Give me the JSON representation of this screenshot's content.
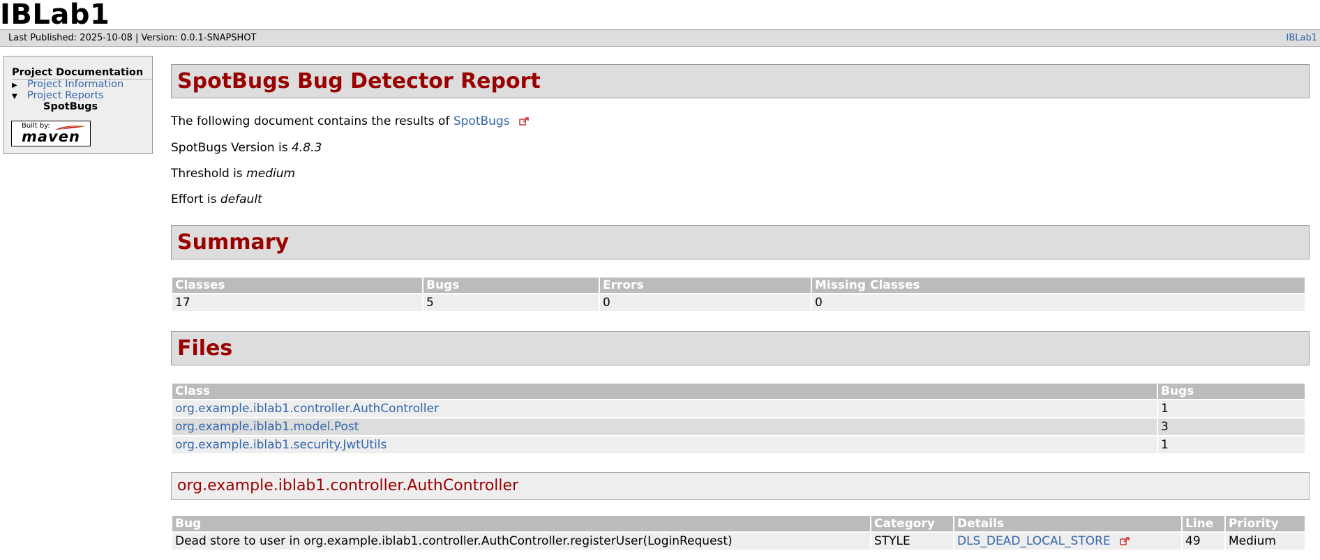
{
  "banner": {
    "title": "IBLab1"
  },
  "breadcrumbs": {
    "left": "Last Published: 2025-10-08 | Version: 0.0.1-SNAPSHOT",
    "right": "IBLab1"
  },
  "nav": {
    "heading": "Project Documentation",
    "items": [
      {
        "label": "Project Information"
      },
      {
        "label": "Project Reports"
      },
      {
        "label": "SpotBugs"
      }
    ],
    "badge": {
      "built_by": "Built by:",
      "word": "maven"
    }
  },
  "report": {
    "title": "SpotBugs Bug Detector Report",
    "intro_text": "The following document contains the results of",
    "intro_link": "SpotBugs",
    "version_label": "SpotBugs Version is",
    "version_value": "4.8.3",
    "threshold_label": "Threshold is",
    "threshold_value": "medium",
    "effort_label": "Effort is",
    "effort_value": "default"
  },
  "summary": {
    "title": "Summary",
    "headers": [
      "Classes",
      "Bugs",
      "Errors",
      "Missing Classes"
    ],
    "row": [
      "17",
      "5",
      "0",
      "0"
    ]
  },
  "files": {
    "title": "Files",
    "headers": [
      "Class",
      "Bugs"
    ],
    "rows": [
      {
        "class": "org.example.iblab1.controller.AuthController",
        "bugs": "1"
      },
      {
        "class": "org.example.iblab1.model.Post",
        "bugs": "3"
      },
      {
        "class": "org.example.iblab1.security.JwtUtils",
        "bugs": "1"
      }
    ]
  },
  "class_section": {
    "title": "org.example.iblab1.controller.AuthController",
    "headers": [
      "Bug",
      "Category",
      "Details",
      "Line",
      "Priority"
    ],
    "rows": [
      {
        "bug": "Dead store to user in org.example.iblab1.controller.AuthController.registerUser(LoginRequest)",
        "category": "STYLE",
        "details": "DLS_DEAD_LOCAL_STORE",
        "line": "49",
        "priority": "Medium"
      }
    ]
  },
  "colors": {
    "heading_red": "#990000",
    "link_blue": "#3366aa",
    "header_gray": "#bbbbbb",
    "box_gray": "#dddddd"
  }
}
